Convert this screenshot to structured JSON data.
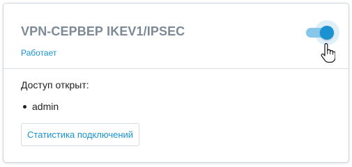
{
  "card": {
    "title": "VPN-СЕРВЕР IKEV1/IPSEC",
    "status": "Работает",
    "access_label": "Доступ открыт:",
    "users": [
      "admin"
    ],
    "stats_button_label": "Статистика подключений"
  },
  "toggle": {
    "state": "on",
    "accent_color": "#1a92d1"
  },
  "cursor": {
    "icon": "hand-pointer-icon"
  }
}
